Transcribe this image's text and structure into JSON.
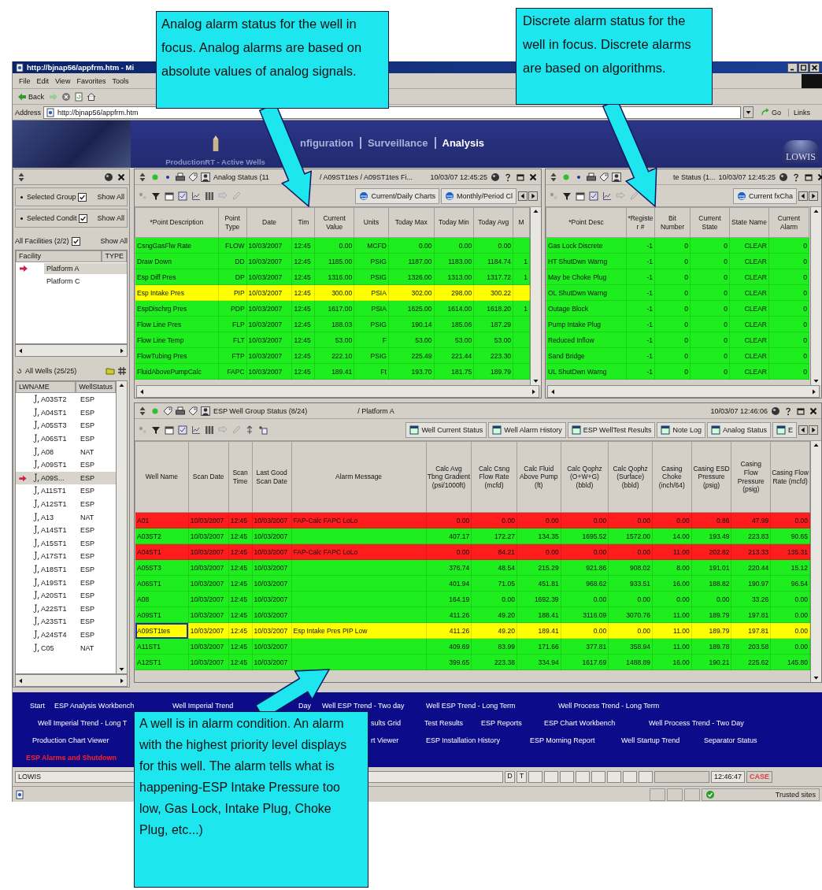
{
  "callouts": [
    {
      "text": "Analog alarm status for the well in focus. Analog alarms are based on absolute values of analog signals."
    },
    {
      "text": "Discrete alarm status for the well in focus. Discrete alarms are based on algorithms."
    },
    {
      "text": "A well is in alarm condition. An alarm with the highest priority level displays for this well. The alarm tells what is happening-ESP Intake Pressure too low, Gas Lock, Intake Plug, Choke Plug, etc...)"
    }
  ],
  "browser": {
    "title": "http://bjnap56/appfrm.htm - Mi",
    "menu": [
      "File",
      "Edit",
      "View",
      "Favorites",
      "Tools"
    ],
    "back": "Back",
    "address_label": "Address",
    "address": "http://bjnap56/appfrm.htm",
    "go": "Go",
    "links": "Links"
  },
  "header": {
    "subtitle": "ProductionRT - Active Wells",
    "tabs": [
      {
        "label": "nfiguration",
        "selected": false
      },
      {
        "label": "Surveillance",
        "selected": false
      },
      {
        "label": "Analysis",
        "selected": true
      }
    ],
    "logo": "LOWIS"
  },
  "sidebar": {
    "filters": [
      {
        "label": "Selected Group",
        "checked": true,
        "action": "Show All"
      },
      {
        "label": "Selected Condit",
        "checked": true,
        "action": "Show All"
      }
    ],
    "facilities": {
      "title": "All Facilities (2/2)",
      "checked": true,
      "action": "Show All",
      "columns": [
        "Facility",
        "TYPE"
      ],
      "items": [
        {
          "name": "Platform A",
          "selected": true
        },
        {
          "name": "Platform C",
          "selected": false
        }
      ]
    },
    "wells": {
      "title": "All Wells (25/25)",
      "columns": [
        "LWNAME",
        "WellStatus"
      ],
      "items": [
        {
          "name": "A03ST2",
          "status": "ESP",
          "selected": false
        },
        {
          "name": "A04ST1",
          "status": "ESP",
          "selected": false
        },
        {
          "name": "A05ST3",
          "status": "ESP",
          "selected": false
        },
        {
          "name": "A06ST1",
          "status": "ESP",
          "selected": false
        },
        {
          "name": "A08",
          "status": "NAT",
          "selected": false
        },
        {
          "name": "A09ST1",
          "status": "ESP",
          "selected": false
        },
        {
          "name": "A09S...",
          "status": "ESP",
          "selected": true
        },
        {
          "name": "A11ST1",
          "status": "ESP",
          "selected": false
        },
        {
          "name": "A12ST1",
          "status": "ESP",
          "selected": false
        },
        {
          "name": "A13",
          "status": "NAT",
          "selected": false
        },
        {
          "name": "A14ST1",
          "status": "ESP",
          "selected": false
        },
        {
          "name": "A15ST1",
          "status": "ESP",
          "selected": false
        },
        {
          "name": "A17ST1",
          "status": "ESP",
          "selected": false
        },
        {
          "name": "A18ST1",
          "status": "ESP",
          "selected": false
        },
        {
          "name": "A19ST1",
          "status": "ESP",
          "selected": false
        },
        {
          "name": "A20ST1",
          "status": "ESP",
          "selected": false
        },
        {
          "name": "A22ST1",
          "status": "ESP",
          "selected": false
        },
        {
          "name": "A23ST1",
          "status": "ESP",
          "selected": false
        },
        {
          "name": "A24ST4",
          "status": "ESP",
          "selected": false
        },
        {
          "name": "C05",
          "status": "NAT",
          "selected": false
        }
      ]
    }
  },
  "analog": {
    "title": "Analog Status (11",
    "path": "/ A09ST1tes / A09ST1tes Fi...",
    "time": "10/03/07 12:45:25",
    "tabs": [
      "Current/Daily Charts",
      "Monthly/Period Cl"
    ],
    "columns": [
      "*Point Description",
      "Point Type",
      "Date",
      "Tim",
      "Current Value",
      "Units",
      "Today Max",
      "Today Min",
      "Today Avg",
      "M"
    ],
    "rows": [
      {
        "color": "#1eee1e",
        "cells": [
          "CsngGasFlw Rate",
          "FLOW",
          "10/03/2007",
          "12:45",
          "0.00",
          "MCFD",
          "0.00",
          "0.00",
          "0.00"
        ]
      },
      {
        "color": "#1eee1e",
        "cells": [
          "Draw Down",
          "DD",
          "10/03/2007",
          "12:45",
          "1185.00",
          "PSIG",
          "1187.00",
          "1183.00",
          "1184.74",
          "1"
        ]
      },
      {
        "color": "#1eee1e",
        "cells": [
          "Esp Diff Pres",
          "DP",
          "10/03/2007",
          "12:45",
          "1316.00",
          "PSIG",
          "1326.00",
          "1313.00",
          "1317.72",
          "1"
        ]
      },
      {
        "color": "#ffff00",
        "cells": [
          "Esp Intake Pres",
          "PIP",
          "10/03/2007",
          "12:45",
          "300.00",
          "PSIA",
          "302.00",
          "298.00",
          "300.22"
        ]
      },
      {
        "color": "#1eee1e",
        "cells": [
          "EspDischrg Pres",
          "PDP",
          "10/03/2007",
          "12:45",
          "1617.00",
          "PSIA",
          "1625.00",
          "1614.00",
          "1618.20",
          "1"
        ]
      },
      {
        "color": "#1eee1e",
        "cells": [
          "Flow Line Pres",
          "FLP",
          "10/03/2007",
          "12:45",
          "188.03",
          "PSIG",
          "190.14",
          "185.06",
          "187.29"
        ]
      },
      {
        "color": "#1eee1e",
        "cells": [
          "Flow Line Temp",
          "FLT",
          "10/03/2007",
          "12:45",
          "53.00",
          "F",
          "53.00",
          "53.00",
          "53.00"
        ]
      },
      {
        "color": "#1eee1e",
        "cells": [
          "FlowTubing Pres",
          "FTP",
          "10/03/2007",
          "12:45",
          "222.10",
          "PSIG",
          "225.49",
          "221.44",
          "223.30"
        ]
      },
      {
        "color": "#1eee1e",
        "cells": [
          "FluidAbovePumpCalc",
          "FAPC",
          "10/03/2007",
          "12:45",
          "189.41",
          "Ft",
          "193.70",
          "181.75",
          "189.79"
        ]
      }
    ]
  },
  "discrete": {
    "title": "te Status (1...",
    "time": "10/03/07 12:45:25",
    "tabs": [
      "Current fxCha"
    ],
    "columns": [
      "*Point Desc",
      "*Register #",
      "Bit Number",
      "Current State",
      "State Name",
      "Current Alarm"
    ],
    "rows": [
      {
        "color": "#1eee1e",
        "cells": [
          "Gas Lock Discrete",
          "-1",
          "0",
          "0",
          "CLEAR",
          "0"
        ]
      },
      {
        "color": "#1eee1e",
        "cells": [
          "HT ShutDwn Warng",
          "-1",
          "0",
          "0",
          "CLEAR",
          "0"
        ]
      },
      {
        "color": "#1eee1e",
        "cells": [
          "May be Choke Plug",
          "-1",
          "0",
          "0",
          "CLEAR",
          "0"
        ]
      },
      {
        "color": "#1eee1e",
        "cells": [
          "OL ShutDwn Warng",
          "-1",
          "0",
          "0",
          "CLEAR",
          "0"
        ]
      },
      {
        "color": "#1eee1e",
        "cells": [
          "Outage Block",
          "-1",
          "0",
          "0",
          "CLEAR",
          "0"
        ]
      },
      {
        "color": "#1eee1e",
        "cells": [
          "Pump Intake Plug",
          "-1",
          "0",
          "0",
          "CLEAR",
          "0"
        ]
      },
      {
        "color": "#1eee1e",
        "cells": [
          "Reduced Inflow",
          "-1",
          "0",
          "0",
          "CLEAR",
          "0"
        ]
      },
      {
        "color": "#1eee1e",
        "cells": [
          "Sand Bridge",
          "-1",
          "0",
          "0",
          "CLEAR",
          "0"
        ]
      },
      {
        "color": "#1eee1e",
        "cells": [
          "UL ShutDwn Warng",
          "-1",
          "0",
          "0",
          "CLEAR",
          "0"
        ]
      }
    ]
  },
  "group": {
    "title": "ESP Well Group Status (8/24)",
    "path": "/ Platform A",
    "time": "10/03/07 12:46:06",
    "tabs": [
      "Well Current Status",
      "Well Alarm History",
      "ESP WellTest Results",
      "Note Log",
      "Analog Status",
      "E"
    ],
    "columns": [
      "Well Name",
      "Scan Date",
      "Scan Time",
      "Last Good Scan Date",
      "Alarm Message",
      "Calc Avg Tbng Gradient (psi/1000ft)",
      "Calc Csng Flow Rate (mcfd)",
      "Calc Fluid Above Pump (ft)",
      "Calc Qophz (O+W+G) (bbld)",
      "Calc Qophz (Surface) (bbld)",
      "Casing Choke (inch/64)",
      "Casing ESD Pressure (psig)",
      "Casing Flow Pressure (psig)",
      "Casing Flow Rate (mcfd)"
    ],
    "rows": [
      {
        "color": "#ff1c1c",
        "focused": false,
        "cells": [
          "A01",
          "10/03/2007",
          "12:45",
          "10/03/2007",
          "FAP-Calc FAPC LoLo",
          "0.00",
          "0.00",
          "0.00",
          "0.00",
          "0.00",
          "0.00",
          "0.86",
          "47.99",
          "0.00"
        ]
      },
      {
        "color": "#1eee1e",
        "focused": false,
        "cells": [
          "A03ST2",
          "10/03/2007",
          "12:45",
          "10/03/2007",
          "",
          "407.17",
          "172.27",
          "134.35",
          "1695.52",
          "1572.00",
          "14.00",
          "193.49",
          "223.83",
          "90.65"
        ]
      },
      {
        "color": "#ff1c1c",
        "focused": false,
        "cells": [
          "A04ST1",
          "10/03/2007",
          "12:45",
          "10/03/2007",
          "FAP-Calc FAPC LoLo",
          "0.00",
          "84.21",
          "0.00",
          "0.00",
          "0.00",
          "11.00",
          "202.82",
          "213.33",
          "135.31"
        ]
      },
      {
        "color": "#1eee1e",
        "focused": false,
        "cells": [
          "A05ST3",
          "10/03/2007",
          "12:45",
          "10/03/2007",
          "",
          "376.74",
          "48.54",
          "215.29",
          "921.86",
          "908.02",
          "8.00",
          "191.01",
          "220.44",
          "15.12"
        ]
      },
      {
        "color": "#1eee1e",
        "focused": false,
        "cells": [
          "A06ST1",
          "10/03/2007",
          "12:45",
          "10/03/2007",
          "",
          "401.94",
          "71.05",
          "451.81",
          "968.62",
          "933.51",
          "16.00",
          "188.82",
          "190.97",
          "96.54"
        ]
      },
      {
        "color": "#1eee1e",
        "focused": false,
        "cells": [
          "A08",
          "10/03/2007",
          "12:45",
          "10/03/2007",
          "",
          "164.19",
          "0.00",
          "1692.39",
          "0.00",
          "0.00",
          "0.00",
          "0.00",
          "33.26",
          "0.00"
        ]
      },
      {
        "color": "#1eee1e",
        "focused": false,
        "cells": [
          "A09ST1",
          "10/03/2007",
          "12:45",
          "10/03/2007",
          "",
          "411.26",
          "49.20",
          "188.41",
          "3116.09",
          "3070.76",
          "11.00",
          "189.79",
          "197.81",
          "0.00"
        ]
      },
      {
        "color": "#ffff00",
        "focused": true,
        "cells": [
          "A09ST1tes",
          "10/03/2007",
          "12:45",
          "10/03/2007",
          "Esp Intake Pres PIP Low",
          "411.26",
          "49.20",
          "189.41",
          "0.00",
          "0.00",
          "11.00",
          "189.79",
          "197.81",
          "0.00"
        ]
      },
      {
        "color": "#1eee1e",
        "focused": false,
        "cells": [
          "A11ST1",
          "10/03/2007",
          "12:45",
          "10/03/2007",
          "",
          "409.69",
          "83.99",
          "171.66",
          "377.81",
          "358.94",
          "11.00",
          "189.78",
          "203.58",
          "0.00"
        ]
      },
      {
        "color": "#1eee1e",
        "focused": false,
        "cells": [
          "A12ST1",
          "10/03/2007",
          "12:45",
          "10/03/2007",
          "",
          "399.65",
          "223.38",
          "334.94",
          "1617.69",
          "1488.89",
          "16.00",
          "190.21",
          "225.62",
          "145.80"
        ]
      }
    ]
  },
  "nav": {
    "rows": [
      {
        "links": [
          {
            "label": "Start",
            "highlighted": false
          },
          {
            "label": "ESP Analysis Workbench",
            "highlighted": false
          },
          {
            "label": "Well Imperial Trend",
            "highlighted": false
          },
          {
            "label": "Day",
            "highlighted": false
          },
          {
            "label": "Well ESP Trend - Two day",
            "highlighted": false
          },
          {
            "label": "Well ESP Trend - Long Term",
            "highlighted": false
          },
          {
            "label": "Well Process Trend - Long Term",
            "highlighted": false
          }
        ]
      },
      {
        "links": [
          {
            "label": "Well Imperial Trend - Long T",
            "highlighted": false
          },
          {
            "label": "sults Grid",
            "highlighted": false
          },
          {
            "label": "Test Results",
            "highlighted": false
          },
          {
            "label": "ESP Reports",
            "highlighted": false
          },
          {
            "label": "ESP Chart Workbench",
            "highlighted": false
          },
          {
            "label": "Well Process Trend - Two Day",
            "highlighted": false
          }
        ]
      },
      {
        "links": [
          {
            "label": "Production Chart Viewer",
            "highlighted": false
          },
          {
            "label": "rt Viewer",
            "highlighted": false
          },
          {
            "label": "ESP Installation History",
            "highlighted": false
          },
          {
            "label": "ESP Morning Report",
            "highlighted": false
          },
          {
            "label": "Well Startup Trend",
            "highlighted": false
          },
          {
            "label": "Separator Status",
            "highlighted": false
          }
        ]
      },
      {
        "links": [
          {
            "label": "ESP Alarms and Shutdown",
            "highlighted": true
          }
        ]
      }
    ]
  },
  "status_bar": {
    "app": "LOWIS",
    "flags": [
      "D",
      "T"
    ],
    "time": "12:46:47",
    "mode": "CASE"
  },
  "browser_status": {
    "zone": "Trusted sites"
  }
}
